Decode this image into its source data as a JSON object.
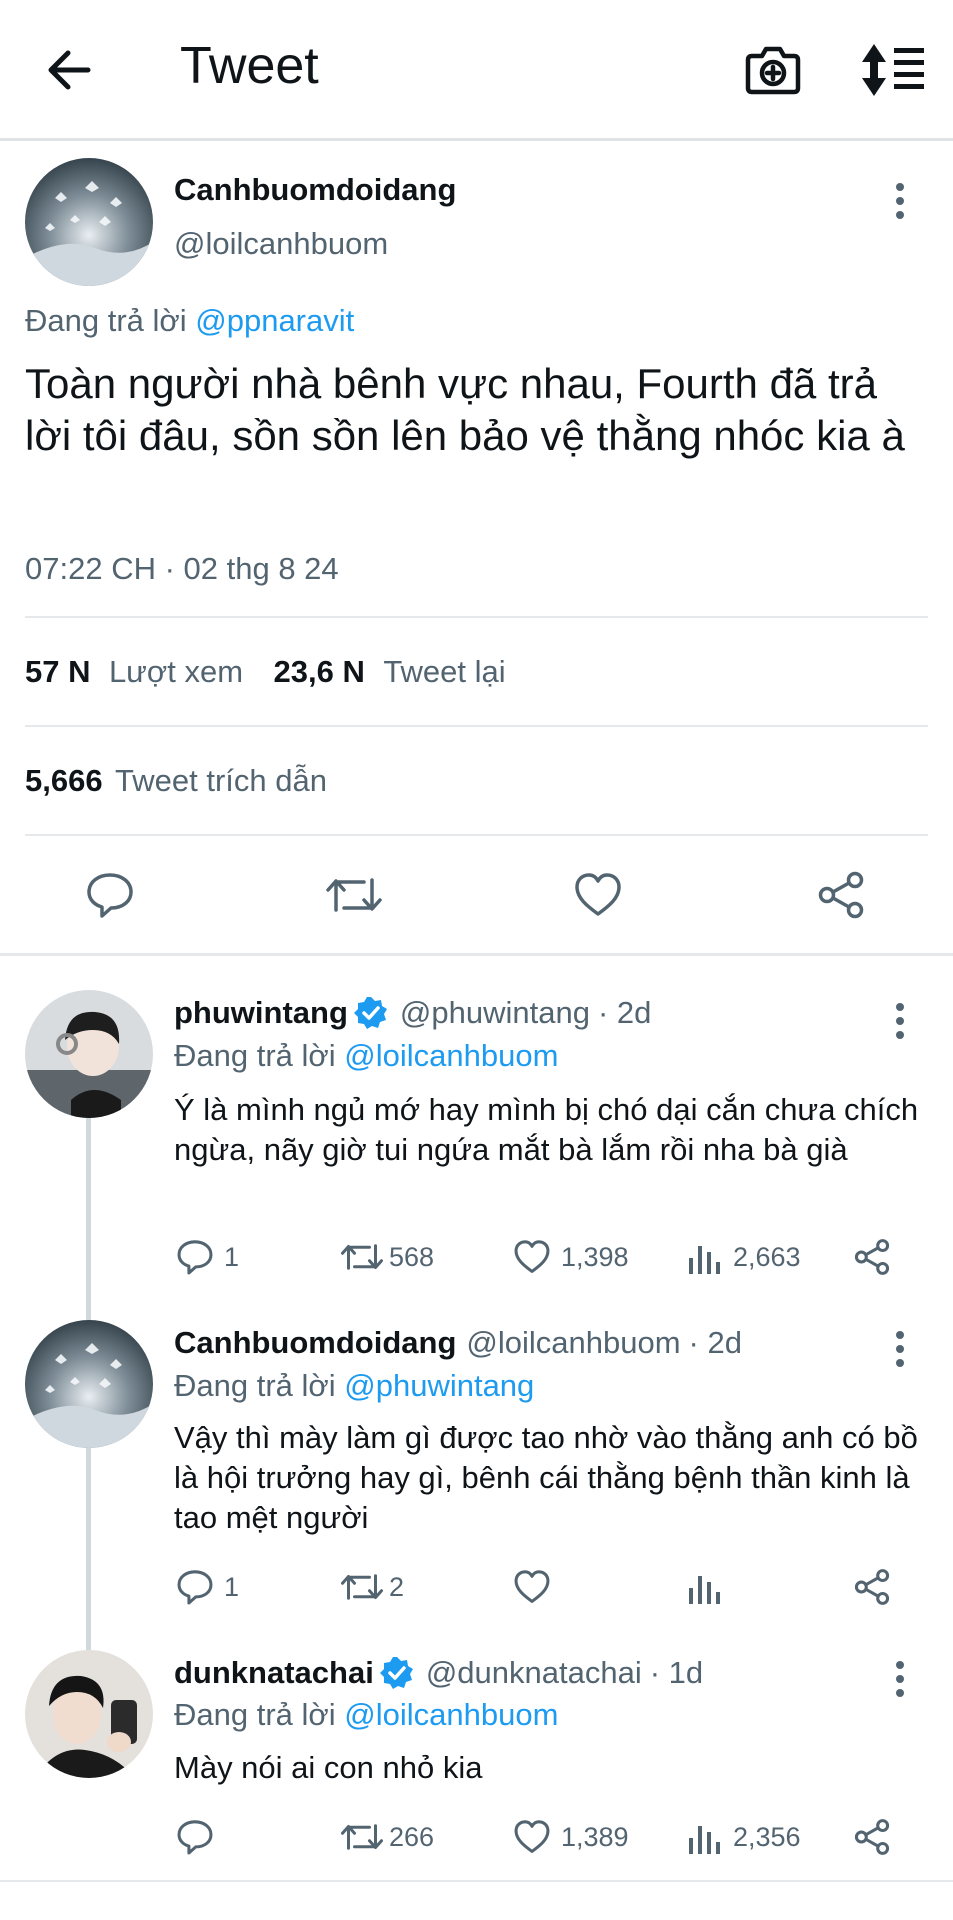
{
  "header": {
    "title": "Tweet"
  },
  "main_tweet": {
    "display_name": "Canhbuomdoidang",
    "handle": "@loilcanhbuom",
    "replying_prefix": "Đang trả lời",
    "replying_to": "@ppnaravit",
    "text": "Toàn người nhà bênh vực nhau, Fourth đã trả lời tôi đâu, sồn sồn lên bảo vệ thằng nhóc kia à",
    "timestamp": "07:22 CH · 02 thg 8 24",
    "views_count": "57 N",
    "views_label": "Lượt xem",
    "retweets_count": "23,6 N",
    "retweets_label": "Tweet lại",
    "quotes_count": "5,666",
    "quotes_label": "Tweet trích dẫn"
  },
  "replies": [
    {
      "display_name": "phuwintang",
      "verified": true,
      "handle": "@phuwintang",
      "age": "· 2d",
      "replying_prefix": "Đang trả lời",
      "replying_to": "@loilcanhbuom",
      "text": "Ý là mình ngủ mớ hay mình bị chó dại cắn chưa chích ngừa, nãy giờ tui ngứa mắt bà lắm rồi nha bà già",
      "replies": "1",
      "retweets": "568",
      "likes": "1,398",
      "views": "2,663"
    },
    {
      "display_name": "Canhbuomdoidang",
      "verified": false,
      "handle": "@loilcanhbuom",
      "age": "· 2d",
      "replying_prefix": "Đang trả lời",
      "replying_to": "@phuwintang",
      "text": "Vậy thì mày làm gì được tao nhờ vào thằng anh có bồ là hội trưởng hay gì, bênh cái thằng bệnh thần kinh là tao mệt người",
      "replies": "1",
      "retweets": "2",
      "likes": "",
      "views": ""
    },
    {
      "display_name": "dunknatachai",
      "verified": true,
      "handle": "@dunknatachai",
      "age": "· 1d",
      "replying_prefix": "Đang trả lời",
      "replying_to": "@loilcanhbuom",
      "text": "Mày nói ai con nhỏ kia",
      "replies": "",
      "retweets": "266",
      "likes": "1,389",
      "views": "2,356"
    }
  ],
  "icons": {
    "back": "arrow-left-icon",
    "camera": "camera-plus-icon",
    "sort": "sort-list-icon",
    "more": "more-vertical-icon",
    "reply": "speech-bubble-icon",
    "retweet": "retweet-icon",
    "like": "heart-icon",
    "share": "share-icon",
    "views": "bar-chart-icon",
    "verified": "verified-badge-icon"
  },
  "colors": {
    "link": "#1d9bf0",
    "secondary": "#536471",
    "text": "#0f1419",
    "verified": "#1d9bf0"
  }
}
